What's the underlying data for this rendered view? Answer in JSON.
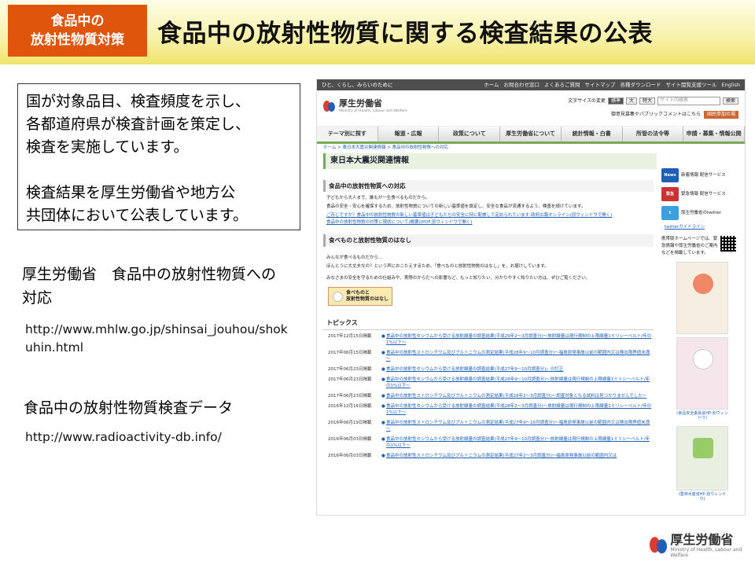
{
  "header": {
    "badge_line1": "食品中の",
    "badge_line2": "放射性物質対策",
    "title": "食品中の放射性物質に関する検査結果の公表"
  },
  "summary": {
    "line1": "国が対象品目、検査頻度を示し、",
    "line2": "各都道府県が検査計画を策定し、",
    "line3": "検査を実施しています。",
    "line4": "検査結果を厚生労働省や地方公",
    "line5": "共団体において公表しています。"
  },
  "sources": {
    "title1": "厚生労働省　食品中の放射性物質への対応",
    "url1": "http://www.mhlw.go.jp/shinsai_jouhou/shokuhin.html",
    "title2": "食品中の放射性物質検査データ",
    "url2": "http://www.radioactivity-db.info/"
  },
  "site": {
    "tagline": "ひと、くらし、みらいのために",
    "top_links": [
      "ホーム",
      "お問合わせ窓口",
      "よくあるご質問",
      "サイトマップ",
      "各種ダウンロード",
      "サイト閲覧支援ツール",
      "English"
    ],
    "logo_name": "厚生労働省",
    "logo_sub": "Ministry of Health, Labour and Welfare",
    "font_size_label": "文字サイズの変更",
    "size_buttons": [
      "標準",
      "大",
      "特大"
    ],
    "search_placeholder": "サイト内検索",
    "search_button": "検索",
    "opinion_text": "御意見募集やパブリックコメントはこちら",
    "opinion_pill": "国民参加の場",
    "nav": [
      "テーマ別に探す",
      "報道・広報",
      "政策について",
      "厚生労働省について",
      "統計情報・白書",
      "所管の法令等",
      "申請・募集・情報公開"
    ],
    "breadcrumb": "ホーム > 東日本大震災関連情報 > 食品中の放射性物質への対応",
    "section_heading": "東日本大震災関連情報",
    "sub_heading": "食品中の放射性物質への対応",
    "intro1": "子どもから大人まで、誰もが一生食べるものだから。",
    "intro2": "食品の安全・安心を確保するため、放射性物質についての新しい基準値を設定し、安全な食品が流通するよう、検査を続けています。",
    "link1": "ご存じですか？食品中の放射性物質の新しい基準値は子どもたちの安全に特に配慮して定められています-政府広報オンライン(別ウィンドウで開く)",
    "link2": "食品中の放射性物質の対策と現状について(概要)(PDF:別ウィンドウで開く)",
    "food_heading": "食べものと放射性物質のはなし",
    "food_text1": "みんなが食べるものだから…",
    "food_text2": "ほんとうに大丈夫なの？という声におこたえするため、「食べものと放射性物質のはなし」を、お届けしています。",
    "food_text3": "みなさまの安全を守るための仕組みや、実際のからだへの影響など、もっと知りたい、分かりやすく知りたい方は、ぜひご覧ください。",
    "food_button_line1": "食べものと",
    "food_button_line2": "放射性物質のはなし",
    "topics_heading": "トピックス",
    "topics": [
      {
        "date": "2017年12月15日掲載",
        "text": "食品中の放射性セシウムから受ける放射線量の調査結果(平成29年2～3月調査分)～放射線量は現行規制の上限線量1ミリシーベルト/年の1%以下～"
      },
      {
        "date": "2017年06月15日掲載",
        "text": "食品中の放射性ストロンチウム及びプルトニウムの測定結果(平成28年9～10月調査分)～福島原発事故以前の範囲内又は検出限界値未満～"
      },
      {
        "date": "2017年06月23日掲載",
        "text": "食品中の放射性セシウムから受ける放射線量の調査結果(平成27年9～10月調査分)」の訂正"
      },
      {
        "date": "2017年06月23日掲載",
        "text": "食品中の放射性セシウムから受ける放射線量の調査結果(平成28年9～10月調査分)～放射線量は現行規制の上限線量1ミリシーベルト/年の1%以下～"
      },
      {
        "date": "2017年06月23日掲載",
        "text": "食品中の放射性ストロンチウム及びプルトニウムの測定結果(平成28年2～3月調査分)～調査対象となる試料は見つかりませんでした～"
      },
      {
        "date": "2016年12月16日掲載",
        "text": "食品中の放射性セシウムから受ける放射線量の調査結果(平成28年2～3月調査分)～放射線量は現行規制の上限線量1ミリシーベルト/年の1%以下～"
      },
      {
        "date": "2016年06月19日掲載",
        "text": "食品中の放射性ストロンチウム及びプルトニウムの測定結果(平成27年9～10月調査分)～福島原発事故以前の範囲内又は検出限界値未満～"
      },
      {
        "date": "2016年06月03日掲載",
        "text": "食品中の放射性セシウムから受ける放射線量の調査結果(平成27年9～10月調査分)～放射線量は現行規制の上限線量1ミリシーベルト/年の1%以下～"
      },
      {
        "date": "2016年06月03日掲載",
        "text": "食品中の放射性ストロンチウム及びプルトニウムの測定結果(平成27年2～3月調査分)～福島原発事故以前の範囲内又は"
      }
    ],
    "side_banners": [
      {
        "icon": "News",
        "text": "新着情報 配信サービス",
        "color": "#1f5fb8"
      },
      {
        "icon": "緊急",
        "text": "緊急情報 配信サービス",
        "color": "#c33"
      },
      {
        "icon": "t",
        "text": "厚生労働省のtwitter",
        "color": "#3aa0e0"
      }
    ],
    "twitter_link": "twitterガイドライン",
    "mobile_text": "携帯版ホームページでは、緊急情報や厚生労働省のご案内などを掲載しています。",
    "poster_caption1": "(食品安全委員会HP:別ウィンドウ)",
    "poster_caption2": "(農林水産省HP:別ウィンドウ)"
  },
  "footer_logo": {
    "name": "厚生労働省",
    "sub": "Ministry of Health, Labour and Welfare"
  }
}
